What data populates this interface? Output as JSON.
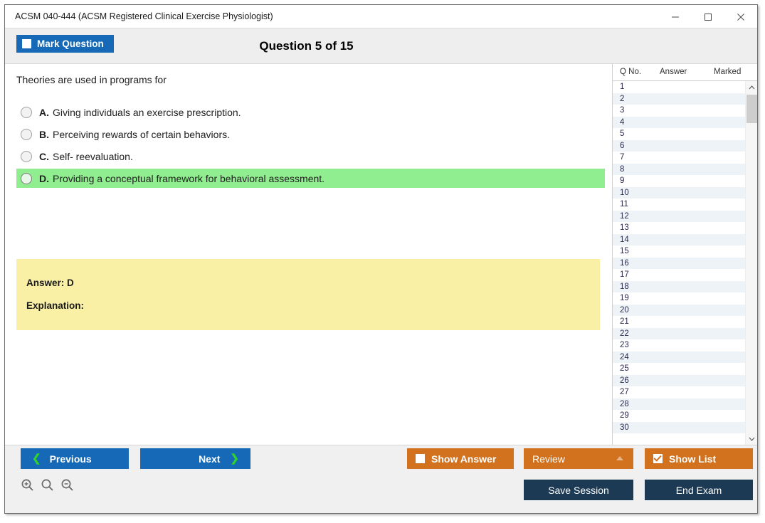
{
  "window": {
    "title": "ACSM 040-444 (ACSM Registered Clinical Exercise Physiologist)",
    "controls": {
      "minimize": "minimize-icon",
      "maximize": "maximize-icon",
      "close": "close-icon"
    }
  },
  "header": {
    "mark_question_label": "Mark Question",
    "question_title": "Question 5 of 15",
    "current_question": 5,
    "total_questions": 15
  },
  "question": {
    "stem": "Theories are used in programs for",
    "options": [
      {
        "letter": "A.",
        "text": "Giving individuals an exercise prescription.",
        "correct": false
      },
      {
        "letter": "B.",
        "text": "Perceiving rewards of certain behaviors.",
        "correct": false
      },
      {
        "letter": "C.",
        "text": "Self- reevaluation.",
        "correct": false
      },
      {
        "letter": "D.",
        "text": "Providing a conceptual framework for behavioral assessment.",
        "correct": true
      }
    ],
    "answer_label": "Answer: D",
    "explanation_label": "Explanation:"
  },
  "list_panel": {
    "columns": [
      "Q No.",
      "Answer",
      "Marked"
    ],
    "rows": [
      {
        "no": "1",
        "answer": "",
        "marked": ""
      },
      {
        "no": "2",
        "answer": "",
        "marked": ""
      },
      {
        "no": "3",
        "answer": "",
        "marked": ""
      },
      {
        "no": "4",
        "answer": "",
        "marked": ""
      },
      {
        "no": "5",
        "answer": "",
        "marked": ""
      },
      {
        "no": "6",
        "answer": "",
        "marked": ""
      },
      {
        "no": "7",
        "answer": "",
        "marked": ""
      },
      {
        "no": "8",
        "answer": "",
        "marked": ""
      },
      {
        "no": "9",
        "answer": "",
        "marked": ""
      },
      {
        "no": "10",
        "answer": "",
        "marked": ""
      },
      {
        "no": "11",
        "answer": "",
        "marked": ""
      },
      {
        "no": "12",
        "answer": "",
        "marked": ""
      },
      {
        "no": "13",
        "answer": "",
        "marked": ""
      },
      {
        "no": "14",
        "answer": "",
        "marked": ""
      },
      {
        "no": "15",
        "answer": "",
        "marked": ""
      },
      {
        "no": "16",
        "answer": "",
        "marked": ""
      },
      {
        "no": "17",
        "answer": "",
        "marked": ""
      },
      {
        "no": "18",
        "answer": "",
        "marked": ""
      },
      {
        "no": "19",
        "answer": "",
        "marked": ""
      },
      {
        "no": "20",
        "answer": "",
        "marked": ""
      },
      {
        "no": "21",
        "answer": "",
        "marked": ""
      },
      {
        "no": "22",
        "answer": "",
        "marked": ""
      },
      {
        "no": "23",
        "answer": "",
        "marked": ""
      },
      {
        "no": "24",
        "answer": "",
        "marked": ""
      },
      {
        "no": "25",
        "answer": "",
        "marked": ""
      },
      {
        "no": "26",
        "answer": "",
        "marked": ""
      },
      {
        "no": "27",
        "answer": "",
        "marked": ""
      },
      {
        "no": "28",
        "answer": "",
        "marked": ""
      },
      {
        "no": "29",
        "answer": "",
        "marked": ""
      },
      {
        "no": "30",
        "answer": "",
        "marked": ""
      }
    ]
  },
  "toolbar": {
    "previous_label": "Previous",
    "next_label": "Next",
    "show_answer_label": "Show Answer",
    "review_label": "Review",
    "show_list_label": "Show List",
    "save_session_label": "Save Session",
    "end_exam_label": "End Exam",
    "zoom_in": "zoom-in-icon",
    "zoom_reset": "zoom-reset-icon",
    "zoom_out": "zoom-out-icon"
  },
  "colors": {
    "primary_blue": "#1569b6",
    "orange": "#d2711e",
    "navy": "#1d3a54",
    "correct_green": "#90ee90",
    "answer_yellow": "#faf0a5",
    "chevron_green": "#2fd02f"
  }
}
